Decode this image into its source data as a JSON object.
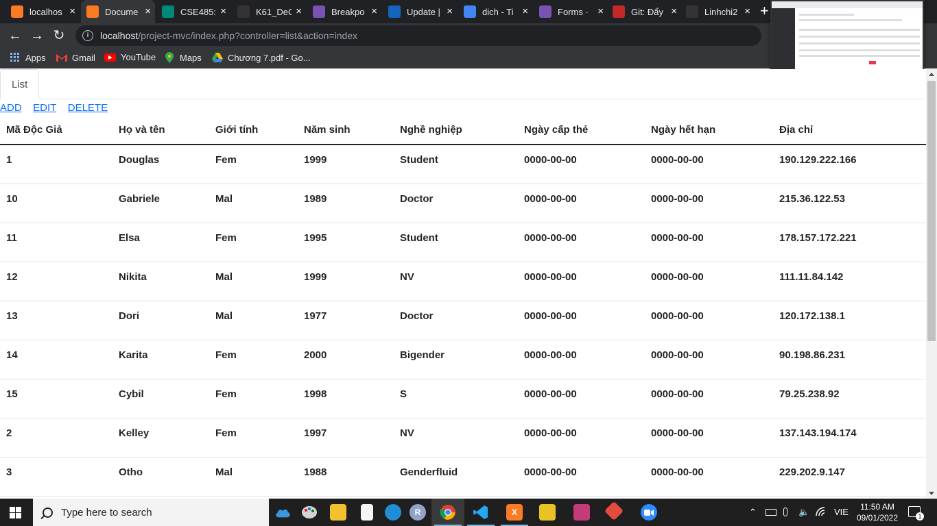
{
  "browser": {
    "tabs": [
      {
        "label": "localhos",
        "icon": "xampp-icon",
        "color": "#fb7a24"
      },
      {
        "label": "Docume",
        "icon": "xampp-icon",
        "color": "#fb7a24"
      },
      {
        "label": "CSE485:",
        "icon": "meet-icon",
        "color": "#00897b"
      },
      {
        "label": "K61_DeC",
        "icon": "github-icon",
        "color": "#333"
      },
      {
        "label": "Breakpo",
        "icon": "bootstrap-icon",
        "color": "#7952b3"
      },
      {
        "label": "Update |",
        "icon": "goom-icon",
        "color": "#1565c0"
      },
      {
        "label": "dich - Ti",
        "icon": "google-icon",
        "color": "#4285f4"
      },
      {
        "label": "Forms · ",
        "icon": "bootstrap-icon",
        "color": "#7952b3"
      },
      {
        "label": "Git: Đẩy",
        "icon": "vietjack-icon",
        "color": "#c62828"
      },
      {
        "label": "Linhchi2",
        "icon": "github-icon",
        "color": "#333"
      }
    ],
    "url_host": "localhost",
    "url_path": "/project-mvc/index.php?controller=list&action=index",
    "bookmarks": [
      {
        "label": "Apps",
        "icon": "apps-grid-icon"
      },
      {
        "label": "Gmail",
        "icon": "gmail-icon"
      },
      {
        "label": "YouTube",
        "icon": "youtube-icon"
      },
      {
        "label": "Maps",
        "icon": "maps-icon"
      },
      {
        "label": "Chương 7.pdf - Go...",
        "icon": "drive-icon"
      }
    ]
  },
  "page": {
    "tab_label": "List",
    "actions": {
      "add": "ADD",
      "edit": "EDIT",
      "delete": "DELETE "
    },
    "columns": [
      "Mã Độc Giả",
      "Họ và tên",
      "Giới tính",
      "Năm sinh",
      "Nghề nghiệp",
      "Ngày cấp thẻ",
      "Ngày hết hạn",
      "Địa chỉ"
    ],
    "rows": [
      [
        "1",
        "Douglas",
        "Fem",
        "1999",
        "Student",
        "0000-00-00",
        "0000-00-00",
        "190.129.222.166"
      ],
      [
        "10",
        "Gabriele",
        "Mal",
        "1989",
        "Doctor",
        "0000-00-00",
        "0000-00-00",
        "215.36.122.53"
      ],
      [
        "11",
        "Elsa",
        "Fem",
        "1995",
        "Student",
        "0000-00-00",
        "0000-00-00",
        "178.157.172.221"
      ],
      [
        "12",
        "Nikita",
        "Mal",
        "1999",
        "NV",
        "0000-00-00",
        "0000-00-00",
        "111.11.84.142"
      ],
      [
        "13",
        "Dori",
        "Mal",
        "1977",
        "Doctor",
        "0000-00-00",
        "0000-00-00",
        "120.172.138.1"
      ],
      [
        "14",
        "Karita",
        "Fem",
        "2000",
        "Bigender",
        "0000-00-00",
        "0000-00-00",
        "90.198.86.231"
      ],
      [
        "15",
        "Cybil",
        "Fem",
        "1998",
        "S",
        "0000-00-00",
        "0000-00-00",
        "79.25.238.92"
      ],
      [
        "2",
        "Kelley",
        "Fem",
        "1997",
        "NV",
        "0000-00-00",
        "0000-00-00",
        "137.143.194.174"
      ],
      [
        "3",
        "Otho",
        "Mal",
        "1988",
        "Genderfluid",
        "0000-00-00",
        "0000-00-00",
        "229.202.9.147"
      ]
    ]
  },
  "taskbar": {
    "search_placeholder": "Type here to search",
    "language": "VIE",
    "time": "11:50 AM",
    "date": "09/01/2022",
    "notification_count": "1"
  }
}
